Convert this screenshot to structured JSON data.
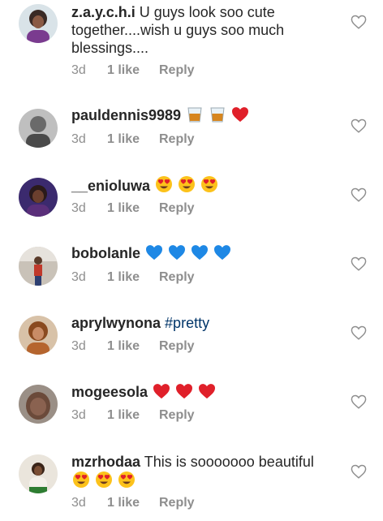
{
  "comments": [
    {
      "username": "z.a.y.c.h.i",
      "text": "U guys look soo cute together....wish u guys soo much blessings....",
      "time": "3d",
      "likes": "1 like",
      "reply": "Reply",
      "emojis": []
    },
    {
      "username": "pauldennis9989",
      "text": "",
      "time": "3d",
      "likes": "1 like",
      "reply": "Reply",
      "emojis": [
        "tumbler-glass",
        "tumbler-glass",
        "red-heart"
      ]
    },
    {
      "username": "__enioluwa",
      "text": "",
      "time": "3d",
      "likes": "1 like",
      "reply": "Reply",
      "emojis": [
        "heart-eyes",
        "heart-eyes",
        "heart-eyes"
      ]
    },
    {
      "username": "bobolanle",
      "text": "",
      "time": "3d",
      "likes": "1 like",
      "reply": "Reply",
      "emojis": [
        "blue-heart",
        "blue-heart",
        "blue-heart",
        "blue-heart"
      ]
    },
    {
      "username": "aprylwynona",
      "text": "#pretty",
      "time": "3d",
      "likes": "1 like",
      "reply": "Reply",
      "emojis": []
    },
    {
      "username": "mogeesola",
      "text": "",
      "time": "3d",
      "likes": "1 like",
      "reply": "Reply",
      "emojis": [
        "red-heart",
        "red-heart",
        "red-heart"
      ]
    },
    {
      "username": "mzrhodaa",
      "text": "This is sooooooo beautiful",
      "time": "3d",
      "likes": "1 like",
      "reply": "Reply",
      "emojis": [
        "heart-eyes",
        "heart-eyes",
        "heart-eyes"
      ]
    }
  ],
  "colors": {
    "text": "#262626",
    "meta": "#8e8e8e",
    "hashtag": "#003569",
    "heart_outline": "#8e8e8e"
  }
}
